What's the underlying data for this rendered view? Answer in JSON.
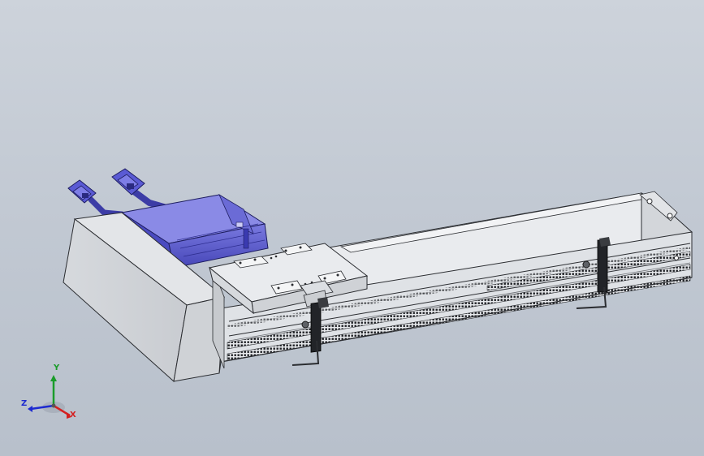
{
  "viewport": {
    "background_top": "#cdd3db",
    "background_bottom": "#b8c0cb"
  },
  "model": {
    "motor_color": "#5b5bd0",
    "body_color": "#d9dce0",
    "rail_color": "#e6e8eb",
    "rack_color": "#1c1e22"
  },
  "triad": {
    "x_label": "X",
    "y_label": "Y",
    "z_label": "Z",
    "x_color": "#d42020",
    "y_color": "#1a9c2a",
    "z_color": "#1d2ad0",
    "icon": "coordinate-triad-icon"
  }
}
